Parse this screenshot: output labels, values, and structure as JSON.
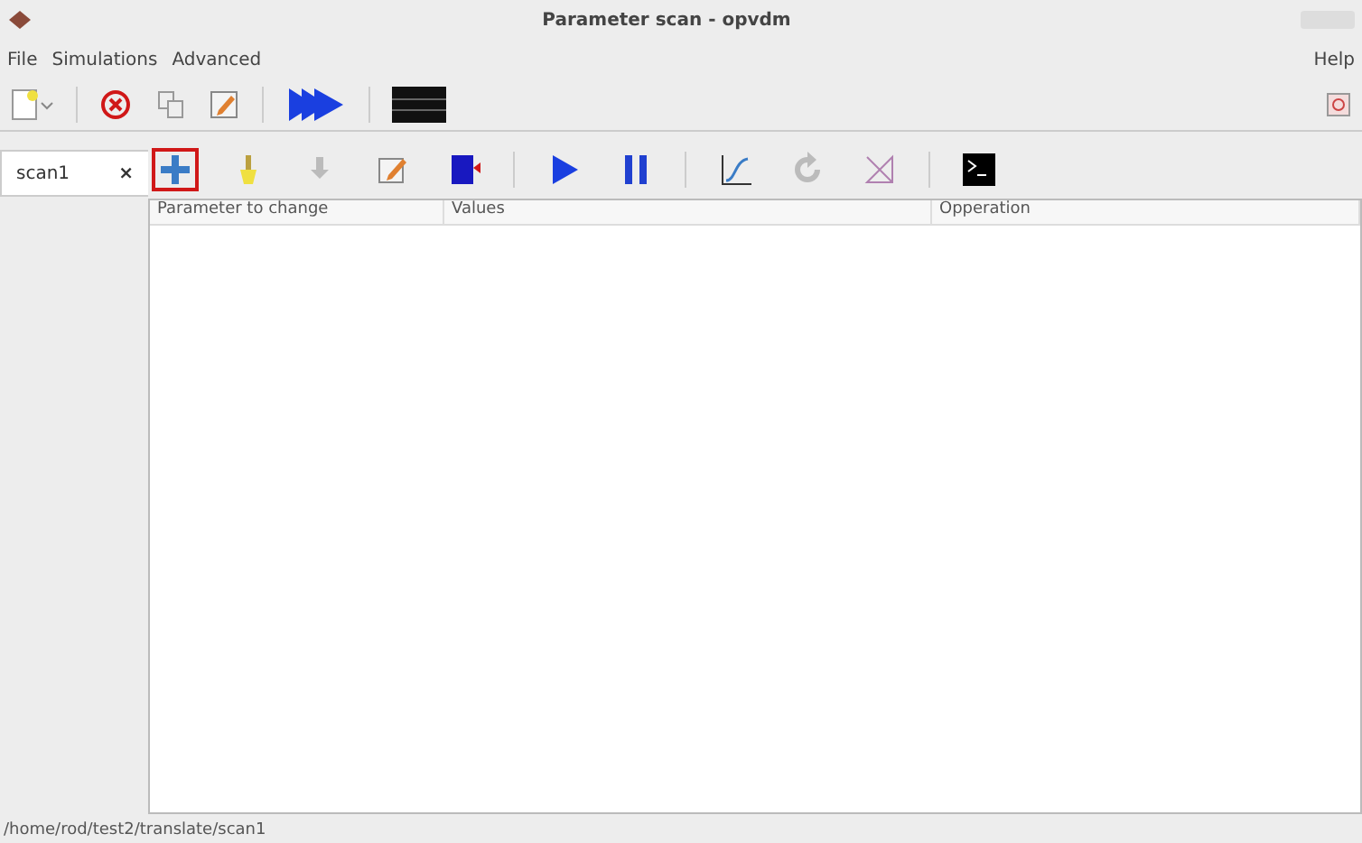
{
  "window": {
    "title": "Parameter scan - opvdm"
  },
  "menu": [
    "File",
    "Simulations",
    "Advanced"
  ],
  "help_menu": "Help",
  "scan_toolbar": {
    "buttons": [
      {
        "highlighted": true
      },
      {
        "highlighted": false
      },
      {
        "highlighted": false
      },
      {
        "highlighted": false
      },
      {
        "highlighted": false
      },
      {
        "highlighted": false
      },
      {
        "highlighted": false
      },
      {
        "highlighted": false
      },
      {
        "highlighted": false
      },
      {
        "highlighted": false
      },
      {
        "highlighted": false
      }
    ]
  },
  "tabs": [
    {
      "label": "scan1",
      "close": "×",
      "selected": true
    }
  ],
  "table": {
    "columns": [
      "Parameter to change",
      "Values",
      "Opperation"
    ]
  },
  "status_bar": "/home/rod/test2/translate/scan1"
}
